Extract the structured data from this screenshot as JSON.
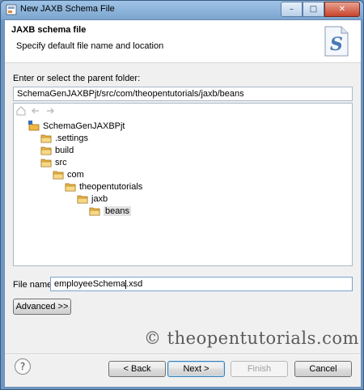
{
  "window": {
    "title": "New JAXB Schema File",
    "controls": {
      "minimize": "–",
      "maximize": "□",
      "close": "✕"
    }
  },
  "banner": {
    "title": "JAXB schema file",
    "subtitle": "Specify default file name and location"
  },
  "parent_folder": {
    "label": "Enter or select the parent folder:",
    "value": "SchemaGenJAXBPjt/src/com/theopentutorials/jaxb/beans"
  },
  "tree": {
    "nodes": [
      {
        "label": "SchemaGenJAXBPjt",
        "type": "project",
        "depth": 0
      },
      {
        "label": ".settings",
        "type": "folder",
        "depth": 1
      },
      {
        "label": "build",
        "type": "folder",
        "depth": 1
      },
      {
        "label": "src",
        "type": "folder",
        "depth": 1
      },
      {
        "label": "com",
        "type": "folder",
        "depth": 2
      },
      {
        "label": "theopentutorials",
        "type": "folder",
        "depth": 3
      },
      {
        "label": "jaxb",
        "type": "folder",
        "depth": 4
      },
      {
        "label": "beans",
        "type": "folder",
        "depth": 5,
        "selected": true
      }
    ]
  },
  "file_name": {
    "label": "File name:",
    "value_before_caret": "employeeSchema",
    "value_after_caret": ".xsd"
  },
  "advanced_button": "Advanced >>",
  "watermark": "© theopentutorials.com",
  "buttons": {
    "back": "< Back",
    "next": "Next >",
    "finish": "Finish",
    "cancel": "Cancel"
  },
  "help_icon": "?",
  "colors": {
    "folder": "#f0b840",
    "selection": "#e2e2e2",
    "accent": "#3c7fb1"
  }
}
